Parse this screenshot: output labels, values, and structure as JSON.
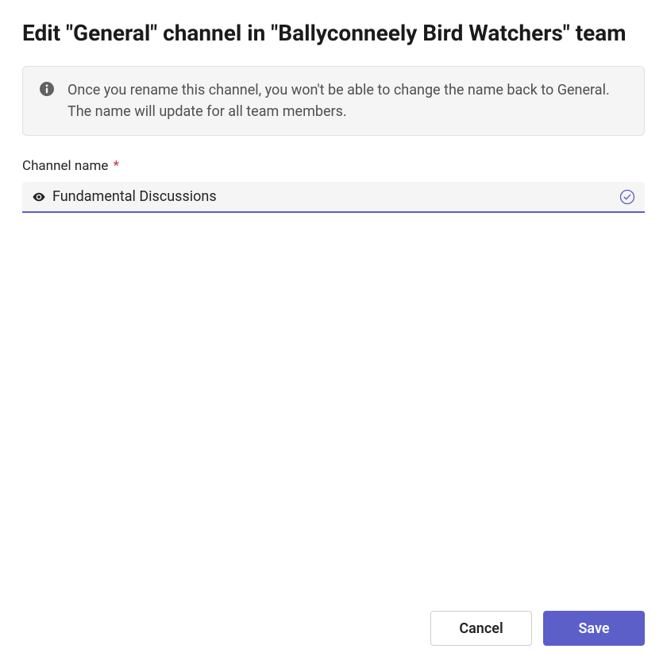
{
  "dialog": {
    "title": "Edit \"General\" channel in \"Ballyconneely Bird Watchers\" team"
  },
  "info_banner": {
    "message": "Once you rename this channel, you won't be able to change the name back to General. The name will update for all team members."
  },
  "channel_name": {
    "label": "Channel name",
    "required_marker": "*",
    "value": "Fundamental Discussions",
    "placeholder": ""
  },
  "buttons": {
    "cancel": "Cancel",
    "save": "Save"
  },
  "colors": {
    "accent": "#5b5fc7",
    "danger": "#c4314b"
  }
}
